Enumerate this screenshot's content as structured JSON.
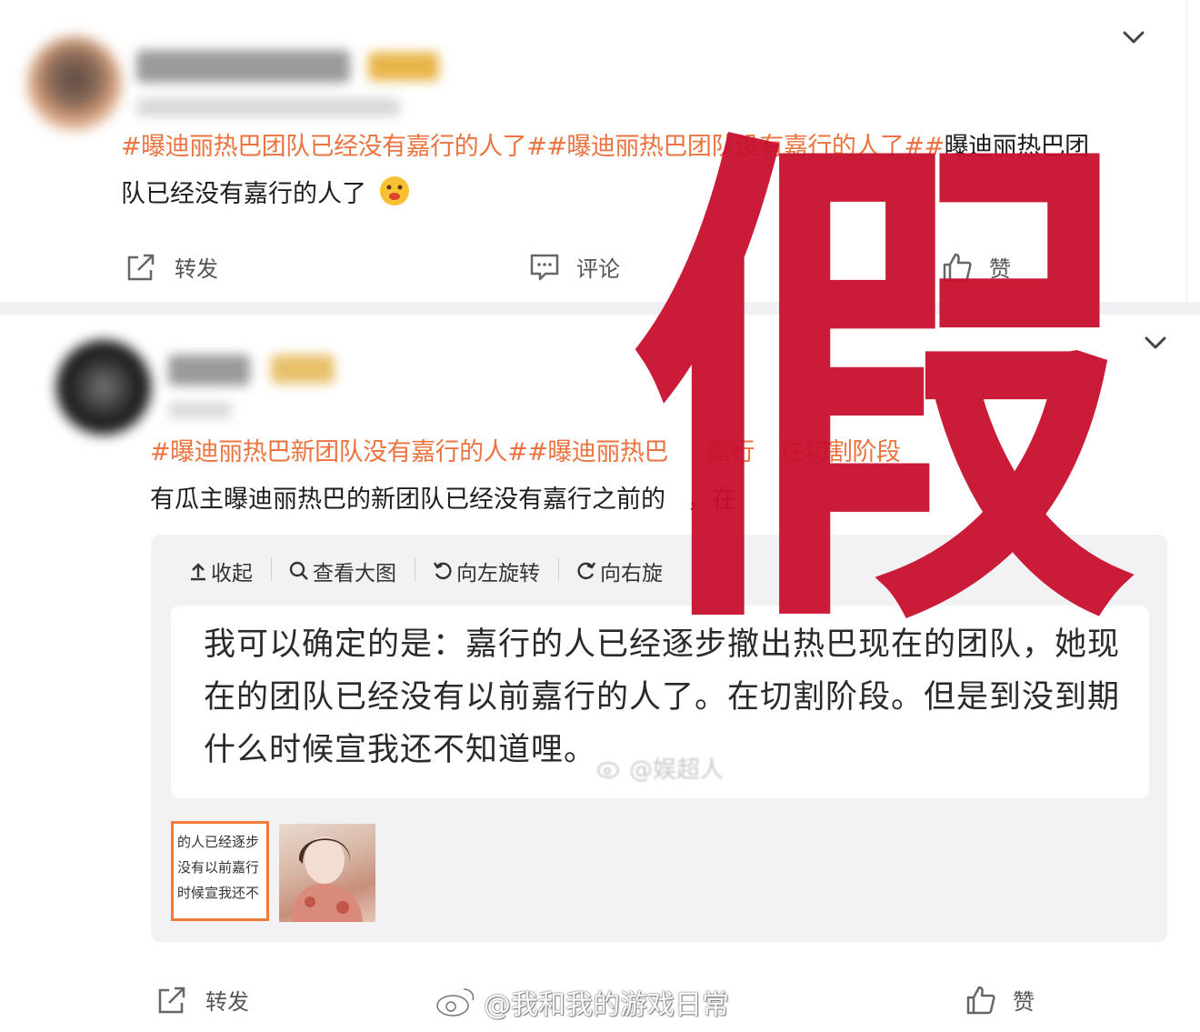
{
  "post1": {
    "hashtags": "#曝迪丽热巴团队已经没有嘉行的人了##曝迪丽热巴团队没有嘉行的人了#",
    "hashtag_tail_plain": "曝迪丽热巴团",
    "body_line2": "队已经没有嘉行的人了",
    "actions": {
      "repost": "转发",
      "comment": "评论",
      "like": "赞"
    }
  },
  "post2": {
    "hashtags": "#曝迪丽热巴新团队没有嘉行的人##曝迪丽热巴",
    "hashtags_tail": "嘉行",
    "hashtags_tail2": "在切割阶段",
    "body": "有瓜主曝迪丽热巴的新团队已经没有嘉行之前的",
    "body_tail": "，在",
    "card": {
      "toolbar": {
        "collapse": "收起",
        "view_large": "查看大图",
        "rotate_left": "向左旋转",
        "rotate_right": "向右旋"
      },
      "quote": "我可以确定的是：嘉行的人已经逐步撤出热巴现在的团队，她现在的团队已经没有以前嘉行的人了。在切割阶段。但是到没到期什么时候宣我还不知道哩。",
      "inner_watermark": "@娱超人",
      "thumb_lines": [
        "的人已经逐步",
        "没有以前嘉行",
        "时候宣我还不"
      ]
    },
    "actions": {
      "repost": "转发",
      "like": "赞"
    }
  },
  "overlay_char": "假",
  "watermark": "@我和我的游戏日常",
  "colors": {
    "hashtag": "#eb7340",
    "overlay": "#c8102e"
  }
}
